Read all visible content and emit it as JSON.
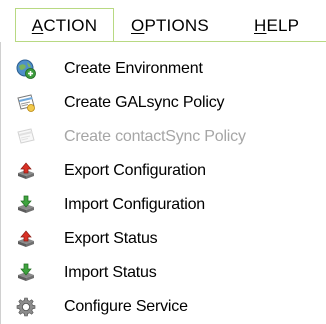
{
  "menubar": {
    "action": {
      "prefix": "",
      "accel": "A",
      "rest": "CTION"
    },
    "options": {
      "prefix": "",
      "accel": "O",
      "rest": "PTIONS"
    },
    "help": {
      "prefix": "",
      "accel": "H",
      "rest": "ELP"
    }
  },
  "colors": {
    "active_border": "#b8d982",
    "disabled_text": "#a6a6a6"
  },
  "items": [
    {
      "label": "Create Environment",
      "icon": "globe-plus-icon",
      "enabled": true
    },
    {
      "label": "Create GALsync Policy",
      "icon": "policy-card-icon",
      "enabled": true
    },
    {
      "label": "Create contactSync Policy",
      "icon": "policy-card-icon",
      "enabled": false
    },
    {
      "label": "Export Configuration",
      "icon": "export-arrow-icon",
      "enabled": true
    },
    {
      "label": "Import Configuration",
      "icon": "import-arrow-icon",
      "enabled": true
    },
    {
      "label": "Export Status",
      "icon": "export-arrow-icon",
      "enabled": true
    },
    {
      "label": "Import Status",
      "icon": "import-arrow-icon",
      "enabled": true
    },
    {
      "label": "Configure Service",
      "icon": "gear-icon",
      "enabled": true
    }
  ]
}
